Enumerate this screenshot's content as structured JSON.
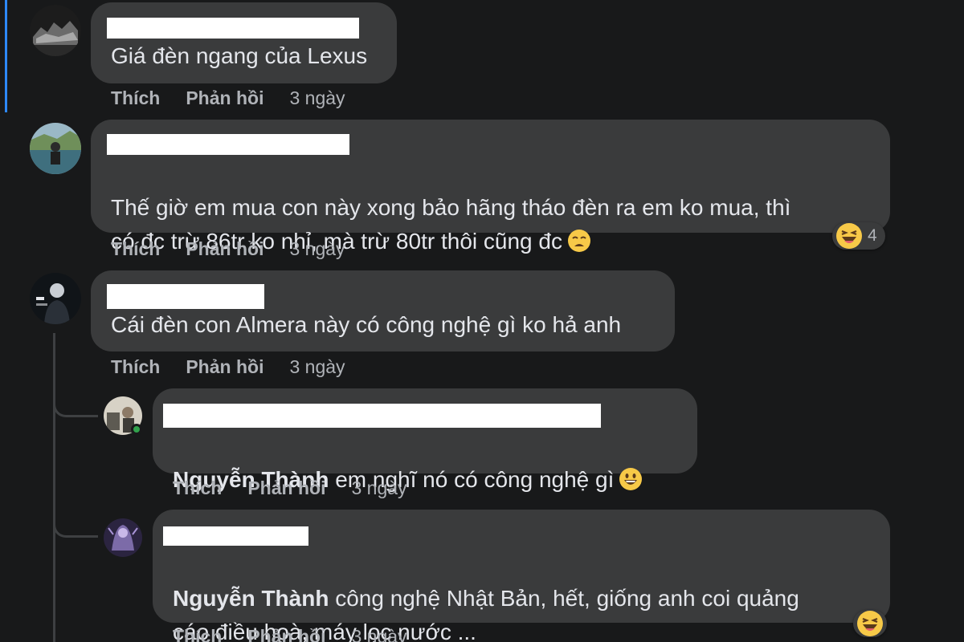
{
  "labels": {
    "like": "Thích",
    "reply": "Phản hồi"
  },
  "comments": [
    {
      "text": "Giá đèn ngang của Lexus",
      "time": "3 ngày"
    },
    {
      "text": "Thế giờ em mua con này xong bảo hãng tháo đèn ra em ko mua, thì\ncó đc trừ 86tr ko nhỉ, mà trừ 80tr thôi cũng đc",
      "time": "3 ngày",
      "reaction_count": "4"
    },
    {
      "text": "Cái đèn con Almera này có công nghệ gì ko hả anh",
      "time": "3 ngày"
    }
  ],
  "replies": [
    {
      "mention": "Nguyễn Thành",
      "text": " em nghĩ nó có công nghệ gì",
      "time": "3 ngày"
    },
    {
      "mention": "Nguyễn Thành",
      "text": " công nghệ Nhật Bản, hết, giống anh coi quảng\ncáo điều hoà, máy lọc nước ...",
      "time": "3 ngày"
    }
  ],
  "icons": {
    "reaction_haha": "haha-icon",
    "emoji_weary": "weary-face-icon",
    "emoji_grin": "grinning-face-icon"
  }
}
